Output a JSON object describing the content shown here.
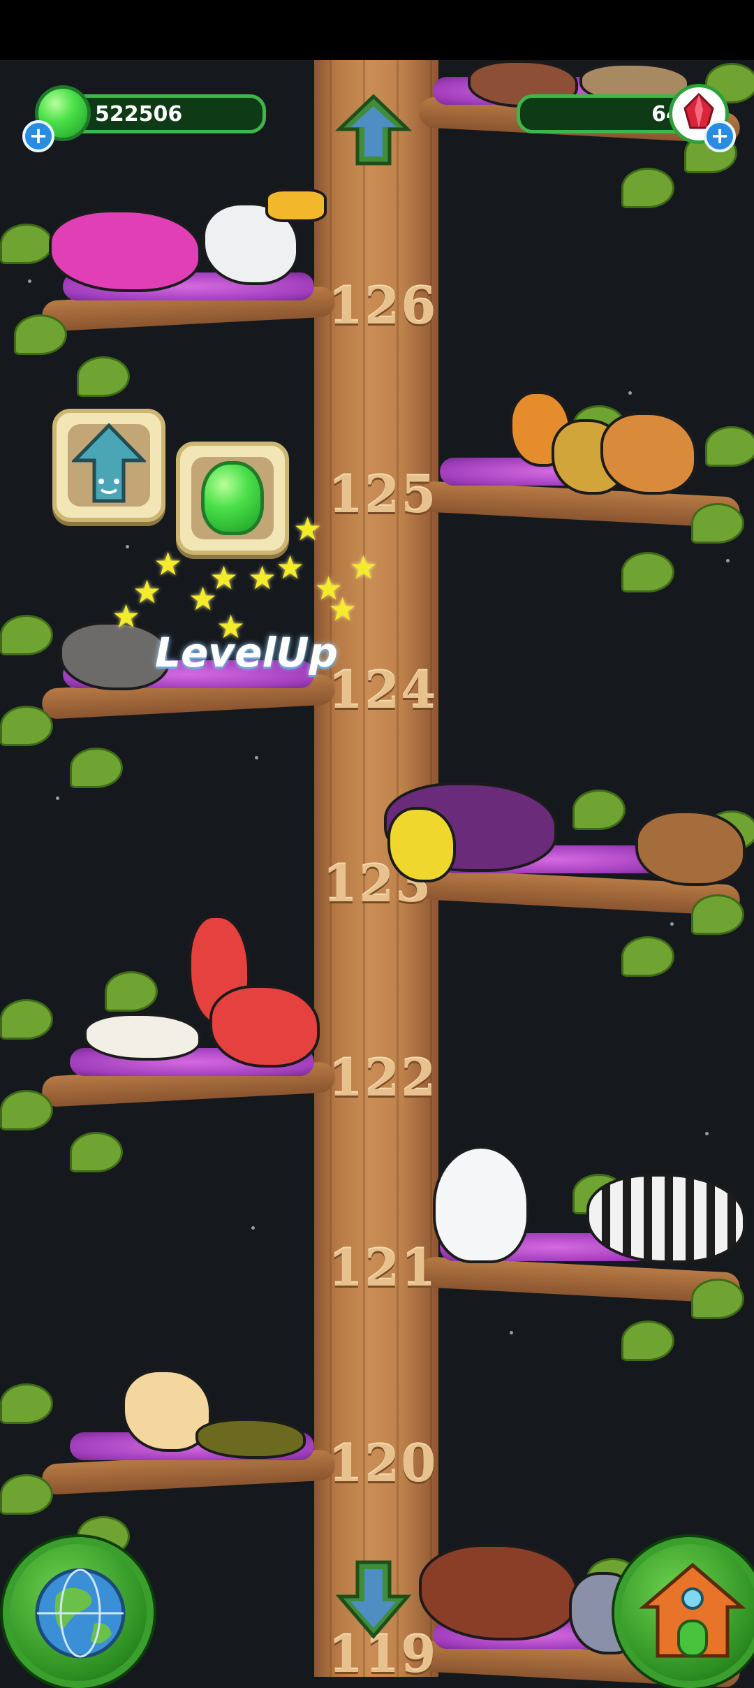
{
  "hud": {
    "jelly_count": "522506",
    "crystal_count": "64",
    "add_jelly_label": "+",
    "add_crystal_label": "+"
  },
  "tree": {
    "levels": [
      "126",
      "125",
      "124",
      "123",
      "122",
      "121",
      "120",
      "119"
    ]
  },
  "popup": {
    "levelup_text": "LevelUp"
  },
  "icons": {
    "jelly": "green-jelly-icon",
    "crystal": "red-crystal-icon",
    "scroll_up": "up-arrow-icon",
    "scroll_down": "down-arrow-icon",
    "world": "globe-icon",
    "home": "house-icon"
  },
  "colors": {
    "background": "#15191e",
    "trunk": "#c98d55",
    "hud_green": "#3fb54a",
    "leaf": "#6fa332",
    "pad": "#a23fbd"
  }
}
